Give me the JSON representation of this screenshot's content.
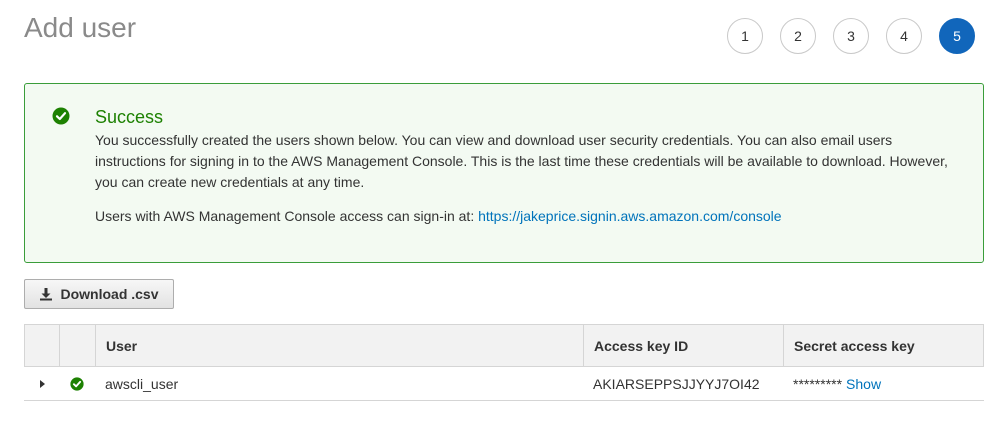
{
  "header": {
    "title": "Add user"
  },
  "steps": [
    "1",
    "2",
    "3",
    "4",
    "5"
  ],
  "alert": {
    "icon": "check-circle-icon",
    "title": "Success",
    "body": "You successfully created the users shown below. You can view and download user security credentials. You can also email users instructions for signing in to the AWS Management Console. This is the last time these credentials will be available to download. However, you can create new credentials at any time.",
    "console_text": "Users with AWS Management Console access can sign-in at:",
    "console_url": "https://jakeprice.signin.aws.amazon.com/console"
  },
  "toolbar": {
    "download_label": "Download .csv",
    "download_icon": "download-icon"
  },
  "table": {
    "columns": [
      "",
      "",
      "User",
      "Access key ID",
      "Secret access key"
    ],
    "rows": [
      {
        "user": "awscli_user",
        "access_key_id": "AKIARSEPPSJJYYJ7OI42",
        "secret_masked": "*********",
        "show_label": "Show"
      }
    ]
  },
  "colors": {
    "success": "#1d8102",
    "link": "#0073bb",
    "active_step": "#1166bb"
  }
}
